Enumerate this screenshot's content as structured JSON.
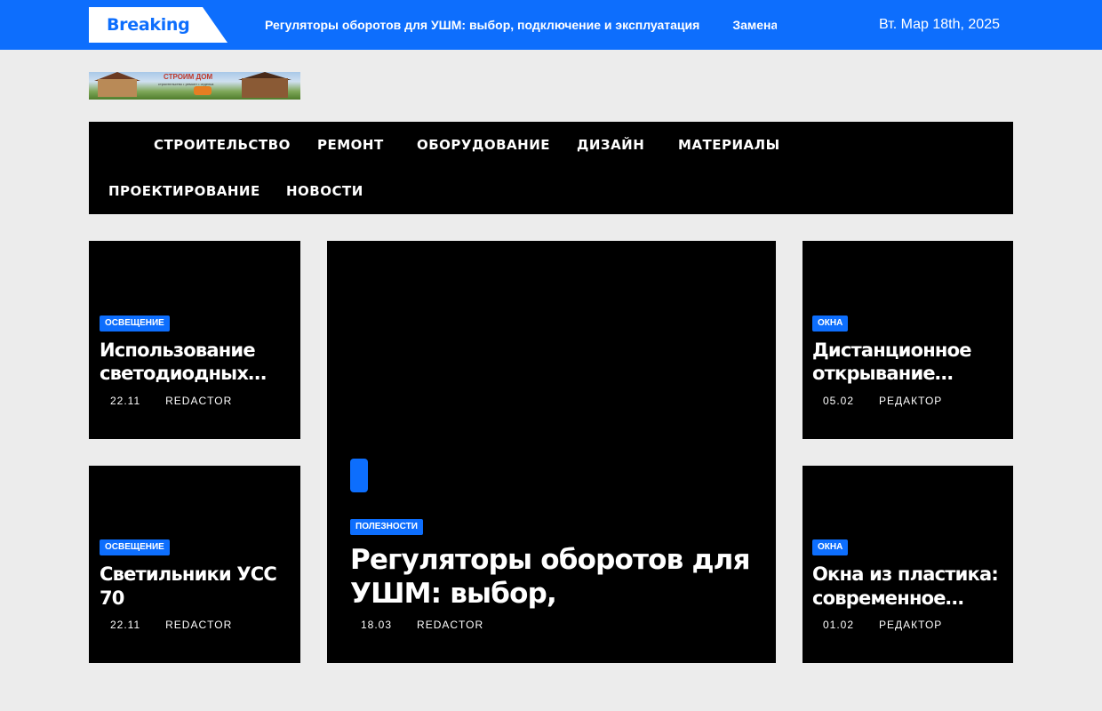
{
  "topbar": {
    "breaking_label": "Breaking",
    "ticker": [
      "Регуляторы оборотов для УШМ: выбор, подключение и эксплуатация",
      "Замена"
    ],
    "date": "Вт. Мар 18th, 2025"
  },
  "logo": {
    "brand": "СТРОИМ ДОМ",
    "tagline": "строительство • ремонт • отделка"
  },
  "nav": [
    "СТРОИТЕЛЬСТВО",
    "РЕМОНТ",
    "ОБОРУДОВАНИЕ",
    "ДИЗАЙН",
    "МАТЕРИАЛЫ",
    "ПРОЕКТИРОВАНИЕ",
    "НОВОСТИ"
  ],
  "cards": [
    {
      "category": "ОСВЕЩЕНИЕ",
      "title": "Использование светодиодных…",
      "date": "22.11",
      "author": "REDACTOR"
    },
    {
      "category": "ОСВЕЩЕНИЕ",
      "title": "Светильники УСС 70",
      "date": "22.11",
      "author": "REDACTOR"
    },
    {
      "category": "ПОЛЕЗНОСТИ",
      "title": "Регуляторы оборотов для УШМ: выбор, подключение…",
      "date": "18.03",
      "author": "REDACTOR"
    },
    {
      "category": "ОКНА",
      "title": "Дистанционное открывание…",
      "date": "05.02",
      "author": "РЕДАКТОР"
    },
    {
      "category": "ОКНА",
      "title": "Окна из пластика: современное…",
      "date": "01.02",
      "author": "РЕДАКТОР"
    }
  ]
}
